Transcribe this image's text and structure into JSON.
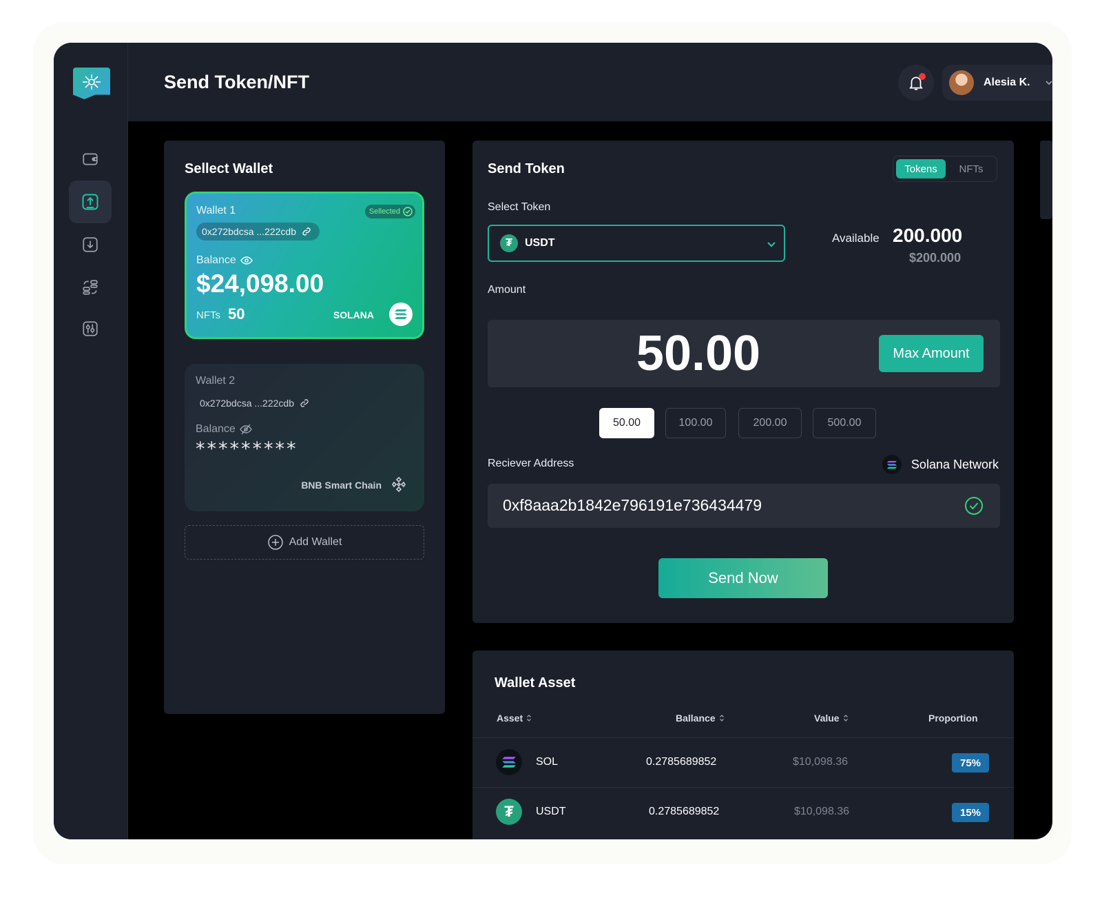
{
  "header": {
    "title": "Send Token/NFT",
    "user_name": "Alesia K."
  },
  "sidebar": {
    "items": [
      {
        "name": "wallet-icon",
        "active": false
      },
      {
        "name": "send-icon",
        "active": true
      },
      {
        "name": "receive-icon",
        "active": false
      },
      {
        "name": "swap-icon",
        "active": false
      },
      {
        "name": "settings-icon",
        "active": false
      }
    ]
  },
  "select_wallet": {
    "title": "Sellect Wallet",
    "add_label": "Add Wallet",
    "wallets": [
      {
        "name": "Wallet 1",
        "address": "0x272bdcsa ...222cdb",
        "badge": "Sellected",
        "balance_label": "Balance",
        "balance": "$24,098.00",
        "nfts_label": "NFTs",
        "nfts": "50",
        "chain": "SOLANA"
      },
      {
        "name": "Wallet 2",
        "address": "0x272bdcsa ...222cdb",
        "balance_label": "Balance",
        "balance_hidden": "*********",
        "chain": "BNB Smart Chain"
      }
    ]
  },
  "send": {
    "title": "Send Token",
    "tabs": [
      "Tokens",
      "NFTs"
    ],
    "select_label": "Select Token",
    "token": "USDT",
    "available_label": "Available",
    "available": "200.000",
    "available_usd": "$200.000",
    "amount_label": "Amount",
    "amount": "50.00",
    "max_label": "Max Amount",
    "presets": [
      "50.00",
      "100.00",
      "200.00",
      "500.00"
    ],
    "receiver_label": "Reciever Address",
    "network": "Solana Network",
    "address": "0xf8aaa2b1842e796191e736434479",
    "send_label": "Send Now"
  },
  "assets": {
    "title": "Wallet Asset",
    "columns": [
      "Asset",
      "Ballance",
      "Value",
      "Proportion"
    ],
    "rows": [
      {
        "asset": "SOL",
        "balance": "0.2785689852",
        "value": "$10,098.36",
        "proportion": "75%"
      },
      {
        "asset": "USDT",
        "balance": "0.2785689852",
        "value": "$10,098.36",
        "proportion": "15%"
      }
    ]
  },
  "colors": {
    "accent": "#1fb39a",
    "panel": "#1c202b",
    "badge_blue": "#1d6fa8"
  }
}
